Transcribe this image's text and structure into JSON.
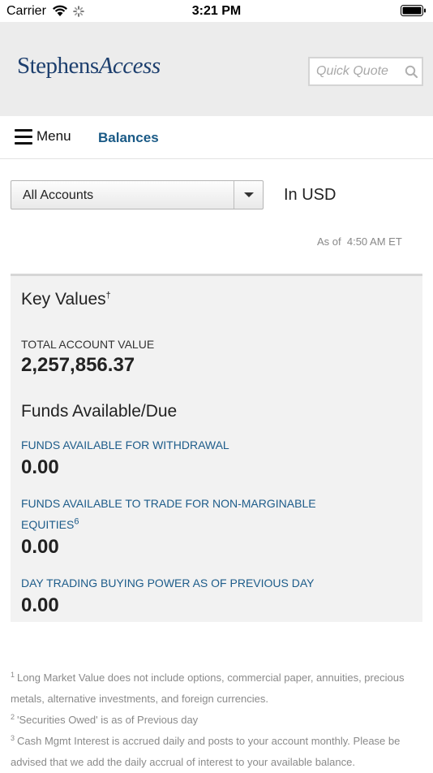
{
  "status_bar": {
    "carrier": "Carrier",
    "time": "3:21 PM"
  },
  "header": {
    "logo_part1": "Stephens",
    "logo_part2": "Access",
    "quote_placeholder": "Quick Quote"
  },
  "navbar": {
    "menu_label": "Menu",
    "page_title": "Balances"
  },
  "filters": {
    "account_selected": "All Accounts",
    "currency": "In USD",
    "as_of_label": "As of",
    "as_of_time": "4:50 AM ET"
  },
  "key_values": {
    "title": "Key Values",
    "title_mark": "†",
    "total_label": "TOTAL ACCOUNT VALUE",
    "total_value": "2,257,856.37"
  },
  "funds": {
    "title": "Funds Available/Due",
    "items": [
      {
        "label": "FUNDS AVAILABLE FOR WITHDRAWAL",
        "value": "0.00"
      },
      {
        "label_line1": "FUNDS AVAILABLE TO TRADE FOR NON-MARGINABLE",
        "label_line2": "EQUITIES",
        "label_sup": "6",
        "value": "0.00"
      },
      {
        "label": "DAY TRADING BUYING POWER AS OF PREVIOUS DAY",
        "value": "0.00"
      }
    ]
  },
  "footnotes": [
    {
      "num": "1",
      "line1": "Long Market Value does not include options, commercial paper, annuities, precious",
      "line2": "metals, alternative investments, and foreign currencies."
    },
    {
      "num": "2",
      "line1": "'Securities Owed' is as of Previous day"
    },
    {
      "num": "3",
      "line1": "Cash Mgmt Interest is accrued daily and posts to your account monthly. Please be",
      "line2": "advised that we add the daily accrual of interest to your available balance."
    }
  ],
  "colors": {
    "brand": "#1d3f6e",
    "accent": "#1a5a86",
    "header_bg": "#ececec",
    "panel_bg": "#f2f2f2"
  },
  "icons": [
    "wifi-icon",
    "spinner-icon",
    "battery-icon",
    "search-icon",
    "menu-icon",
    "chevron-down-icon"
  ]
}
